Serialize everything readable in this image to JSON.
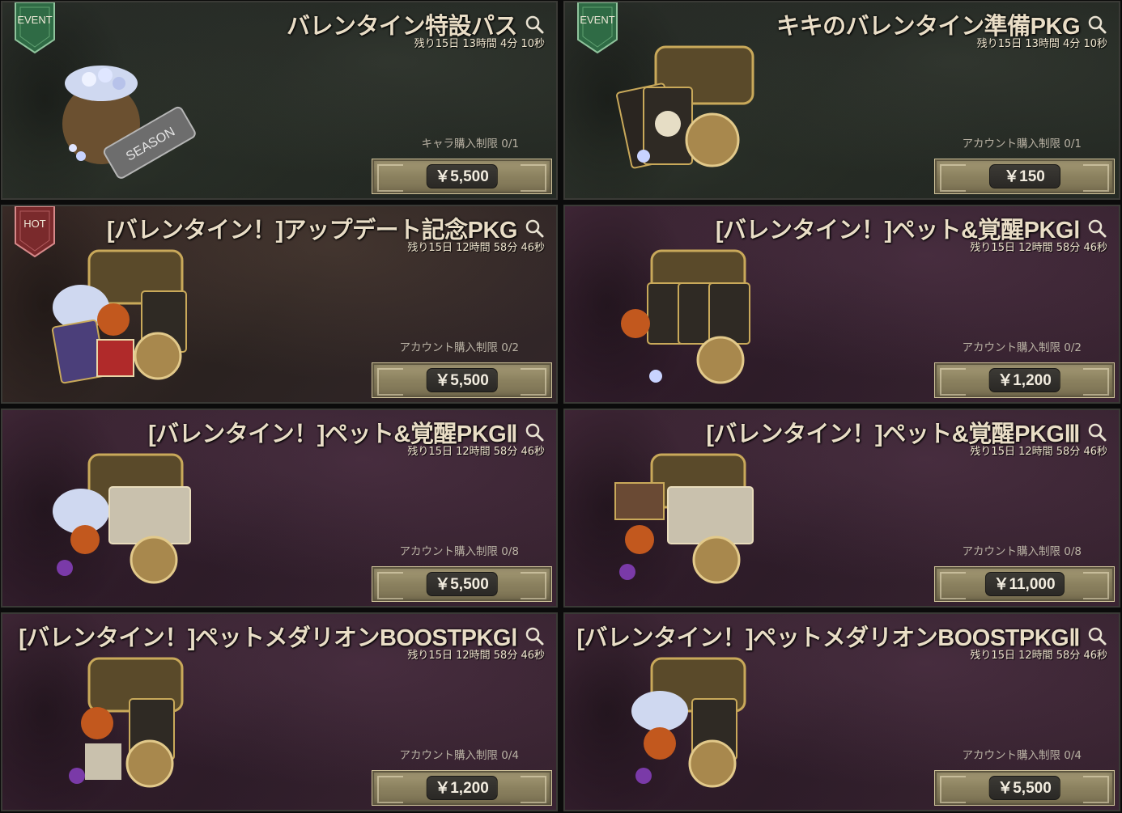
{
  "cards": [
    {
      "title": "バレンタイン特設パス",
      "timer": "残り15日 13時間 4分 10秒",
      "limit": "キャラ購入制限 0/1",
      "price": "￥5,500",
      "badge": "EVENT",
      "badge_color": "#2f6b45",
      "theme": "dark",
      "art_label": "SEASON"
    },
    {
      "title": "キキのバレンタイン準備PKG",
      "timer": "残り15日 13時間 4分 10秒",
      "limit": "アカウント購入制限 0/1",
      "price": "￥150",
      "badge": "EVENT",
      "badge_color": "#2f6b45",
      "theme": "dark",
      "art_label": ""
    },
    {
      "title": "[バレンタイン！]アップデート記念PKG",
      "timer": "残り15日 12時間 58分 46秒",
      "limit": "アカウント購入制限 0/2",
      "price": "￥5,500",
      "badge": "HOT",
      "badge_color": "#7a2a2c",
      "theme": "brown",
      "art_label": ""
    },
    {
      "title": "[バレンタイン！]ペット&覚醒PKGⅠ",
      "timer": "残り15日 12時間 58分 46秒",
      "limit": "アカウント購入制限 0/2",
      "price": "￥1,200",
      "badge": "",
      "badge_color": "",
      "theme": "purple",
      "art_label": ""
    },
    {
      "title": "[バレンタイン！]ペット&覚醒PKGⅡ",
      "timer": "残り15日 12時間 58分 46秒",
      "limit": "アカウント購入制限 0/8",
      "price": "￥5,500",
      "badge": "",
      "badge_color": "",
      "theme": "purple",
      "art_label": ""
    },
    {
      "title": "[バレンタイン！]ペット&覚醒PKGⅢ",
      "timer": "残り15日 12時間 58分 46秒",
      "limit": "アカウント購入制限 0/8",
      "price": "￥11,000",
      "badge": "",
      "badge_color": "",
      "theme": "purple",
      "art_label": ""
    },
    {
      "title": "[バレンタイン！]ペットメダリオンBOOSTPKGⅠ",
      "timer": "残り15日 12時間 58分 46秒",
      "limit": "アカウント購入制限 0/4",
      "price": "￥1,200",
      "badge": "",
      "badge_color": "",
      "theme": "purple",
      "art_label": ""
    },
    {
      "title": "[バレンタイン！]ペットメダリオンBOOSTPKGⅡ",
      "timer": "残り15日 12時間 58分 46秒",
      "limit": "アカウント購入制限 0/4",
      "price": "￥5,500",
      "badge": "",
      "badge_color": "",
      "theme": "purple",
      "art_label": ""
    }
  ],
  "icons": {
    "search": "search-icon",
    "badge": "ribbon-badge-icon",
    "art": "package-items-icon"
  }
}
